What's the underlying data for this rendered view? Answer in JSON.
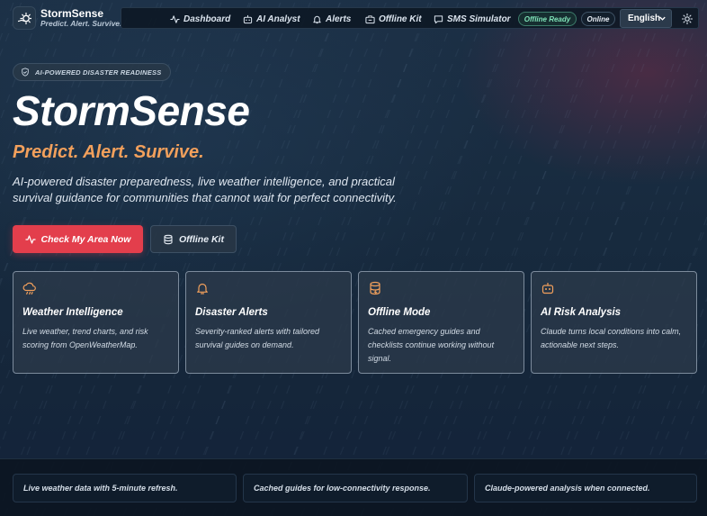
{
  "brand": {
    "name": "StormSense",
    "tagline": "Predict. Alert. Survive."
  },
  "nav": {
    "items": [
      {
        "label": "Dashboard",
        "icon": "activity-icon"
      },
      {
        "label": "AI Analyst",
        "icon": "robot-icon"
      },
      {
        "label": "Alerts",
        "icon": "bell-icon"
      },
      {
        "label": "Offline Kit",
        "icon": "briefcase-icon"
      },
      {
        "label": "SMS Simulator",
        "icon": "message-icon"
      }
    ],
    "offline_status": "Offline Ready",
    "online_status": "Online",
    "language": "English",
    "theme_icon": "sun-icon"
  },
  "hero": {
    "badge": "AI-POWERED DISASTER READINESS",
    "title": "StormSense",
    "tagline": "Predict. Alert. Survive.",
    "description": "AI-powered disaster preparedness, live weather intelligence, and practical survival guidance for communities that cannot wait for perfect connectivity.",
    "primary_button": "Check My Area Now",
    "secondary_button": "Offline Kit"
  },
  "features": [
    {
      "icon": "cloud-rain-icon",
      "title": "Weather Intelligence",
      "text": "Live weather, trend charts, and risk scoring from OpenWeatherMap."
    },
    {
      "icon": "bell-icon",
      "title": "Disaster Alerts",
      "text": "Severity-ranked alerts with tailored survival guides on demand."
    },
    {
      "icon": "database-icon",
      "title": "Offline Mode",
      "text": "Cached emergency guides and checklists continue working without signal."
    },
    {
      "icon": "robot-icon",
      "title": "AI Risk Analysis",
      "text": "Claude turns local conditions into calm, actionable next steps."
    }
  ],
  "footer": [
    "Live weather data with 5-minute refresh.",
    "Cached guides for low-connectivity response.",
    "Claude-powered analysis when connected."
  ],
  "colors": {
    "accent_red": "#e33e4c",
    "accent_orange": "#f2a05c",
    "offline_green": "#7fe3b8",
    "background": "#172a3e"
  }
}
